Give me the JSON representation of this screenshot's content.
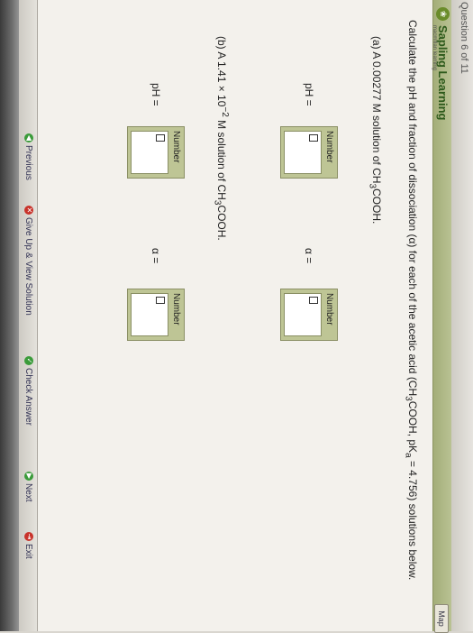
{
  "header": {
    "page_counter": "Question 6 of 11"
  },
  "brand": {
    "name": "Sapling Learning",
    "sub": "macmillan learning",
    "logo_glyph": "❀"
  },
  "map_button": {
    "label": "Map"
  },
  "question": {
    "prefix": "Calculate the pH and fraction of dissociation (α) for each of the acetic acid (CH",
    "sub3": "3",
    "middle": "COOH, pK",
    "sub_a": "a",
    "suffix": " = 4.756) solutions below."
  },
  "part_a": {
    "label_prefix": "(a) A 0.00277 M solution of CH",
    "sub3": "3",
    "label_suffix": "COOH."
  },
  "part_b": {
    "label_prefix": "(b) A 1.41 × 10",
    "exp": "−2",
    "label_mid": " M solution of CH",
    "sub3": "3",
    "label_suffix": "COOH."
  },
  "fields": {
    "box_title": "Number",
    "ph_label": "pH =",
    "alpha_label": "α ="
  },
  "nav": {
    "previous": "Previous",
    "give_up": "Give Up & View Solution",
    "check": "Check Answer",
    "next": "Next",
    "exit": "Exit"
  },
  "colors": {
    "brand_green": "#2d5a1b",
    "box_fill": "#bec595"
  }
}
